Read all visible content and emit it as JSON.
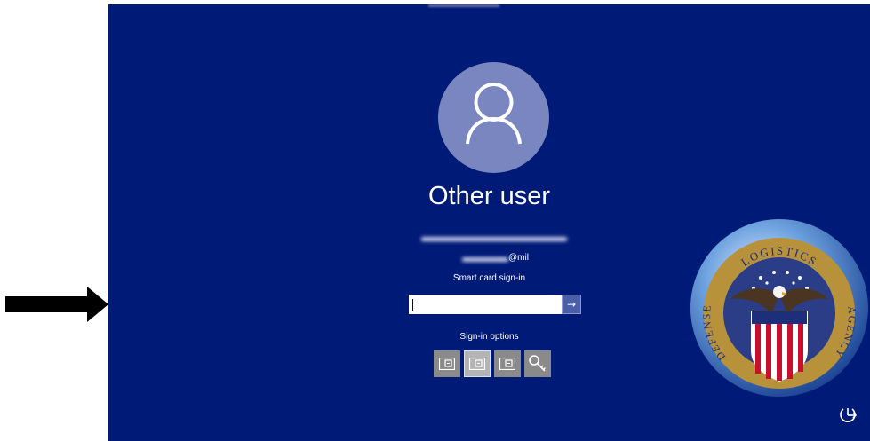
{
  "user": {
    "name": "Other user",
    "email_suffix": "@mil"
  },
  "smartcard": {
    "label": "Smart card sign-in",
    "pin_placeholder": "",
    "submit_glyph": "→"
  },
  "signin_options": {
    "label": "Sign-in options",
    "options": [
      {
        "icon": "smart-card-icon"
      },
      {
        "icon": "smart-card-icon",
        "selected": true
      },
      {
        "icon": "smart-card-icon"
      },
      {
        "icon": "key-icon"
      }
    ]
  },
  "seal": {
    "top_text": "LOGISTICS",
    "left_text": "DEFENSE",
    "right_text": "AGENCY"
  },
  "colors": {
    "background": "#001a77",
    "avatar": "#7a86bf",
    "submit": "#4b5ea8"
  }
}
